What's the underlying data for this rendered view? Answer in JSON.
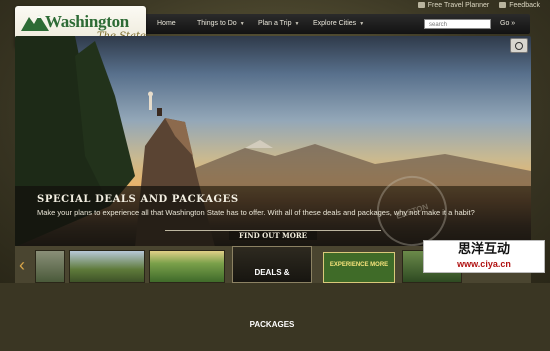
{
  "util_links": [
    "Free Travel Planner",
    "Feedback"
  ],
  "logo": {
    "wordmark": "Washington",
    "tagline": "The State"
  },
  "nav": {
    "items": [
      {
        "label": "Home",
        "dropdown": false
      },
      {
        "label": "Things to Do",
        "dropdown": true
      },
      {
        "label": "Plan a Trip",
        "dropdown": true
      },
      {
        "label": "Explore Cities",
        "dropdown": true
      }
    ],
    "search_placeholder": "search",
    "go_label": "Go »"
  },
  "hero": {
    "title": "SPECIAL DEALS AND PACKAGES",
    "text": "Make your plans to experience all that Washington State has to offer. With all of these deals and packages, why not make it a habit?",
    "cta": "FIND OUT MORE",
    "stamp_text": "EASTON"
  },
  "carousel": {
    "prev_icon": "‹",
    "deals_label": "DEALS & PACKAGES",
    "promo_label": "EXPERIENCE MORE"
  },
  "watermark": {
    "cn": "思洋互动",
    "url": "www.ciya.cn"
  },
  "colors": {
    "logo_green": "#2d6b35",
    "nav_bg": "#1a1a1a",
    "accent_gold": "#d7a54a"
  }
}
